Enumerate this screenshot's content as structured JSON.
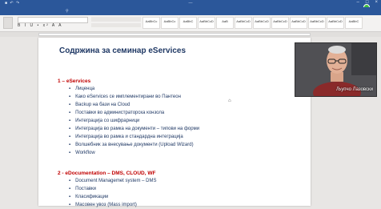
{
  "document": {
    "heading": "Содржина за семинар eServices",
    "section1": {
      "title": "1 – eServices",
      "items": [
        "Лиценца",
        "Како eServices се имплементирани во Пантеон",
        "Backup на бази на Cloud",
        "Поставки во администраторска конзола",
        "Интеграција со шифрарници",
        "Интеграција во рамка на документи – типови на форми",
        "Интеграција во рамка и стандардна интеграција",
        "Волшебник за внесување документи (Upload Wizard)",
        "Workflow"
      ]
    },
    "section2": {
      "title": "2 - eDocumentation – DMS, CLOUD, WF",
      "items": [
        "Document Managemet system – DMS",
        "Поставки",
        "Класификации",
        "Масовен увоз (Mass import)"
      ]
    }
  },
  "webcam": {
    "name": "Љупчо Лазовски"
  },
  "colors": {
    "title_bar": "#2b579a",
    "heading": "#1f3864",
    "section_title": "#c00000",
    "presence": "#3ec13e"
  }
}
